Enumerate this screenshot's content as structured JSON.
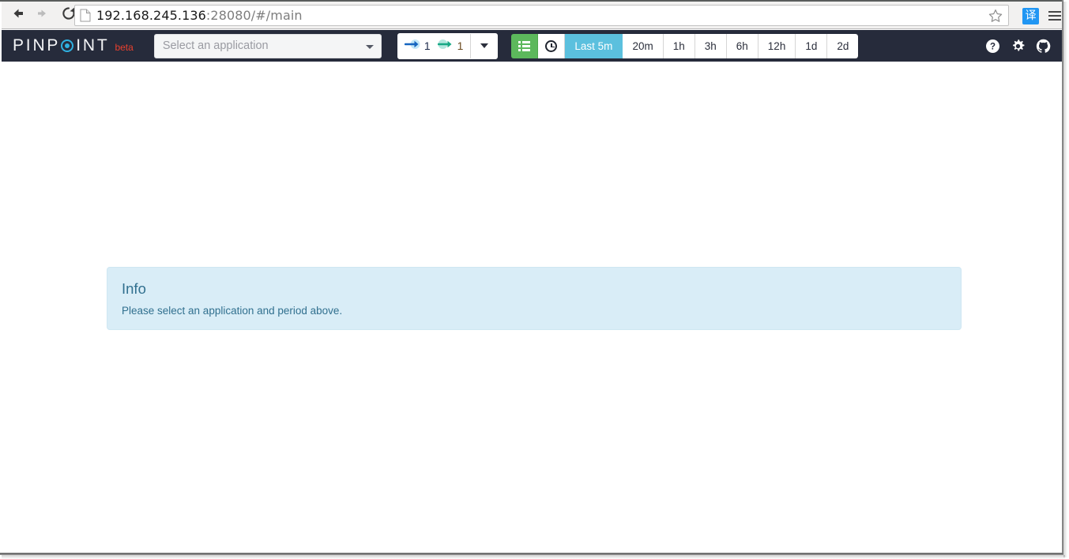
{
  "browser": {
    "back_icon": "arrow-left-icon",
    "forward_icon": "arrow-right-icon",
    "reload_icon": "reload-icon",
    "page_icon": "page-document-icon",
    "url_host": "192.168.245.136",
    "url_rest": ":28080/#/main",
    "url_full": "192.168.245.136:28080/#/main",
    "star_icon": "bookmark-star-icon",
    "translate_label": "译",
    "menu_icon": "hamburger-menu-icon"
  },
  "navbar": {
    "logo": {
      "part1": "PINP",
      "part2": "INT",
      "beta": "beta",
      "accent_color": "#2fb0e0",
      "beta_color": "#e8402e"
    },
    "application_select": {
      "placeholder": "Select an application",
      "value": ""
    },
    "server_counts": {
      "inbound_label": "1",
      "outbound_label": "1",
      "inbound_icon": "arrow-inbound-icon",
      "outbound_icon": "arrow-outbound-icon",
      "caret_icon": "caret-down-icon"
    },
    "tools": {
      "layout_icon": "th-list-icon",
      "clock_icon": "clock-icon"
    },
    "time_range": {
      "options": [
        "Last 5m",
        "20m",
        "1h",
        "3h",
        "6h",
        "12h",
        "1d",
        "2d"
      ],
      "selected": "Last 5m",
      "active_color": "#5bc0de"
    },
    "right_icons": {
      "help": "help-circle-icon",
      "settings": "gear-icon",
      "github": "github-icon"
    },
    "background_color": "#262b3b"
  },
  "content": {
    "alert": {
      "title": "Info",
      "message": "Please select an application and period above.",
      "background_color": "#d9edf7",
      "text_color": "#31708f"
    }
  }
}
